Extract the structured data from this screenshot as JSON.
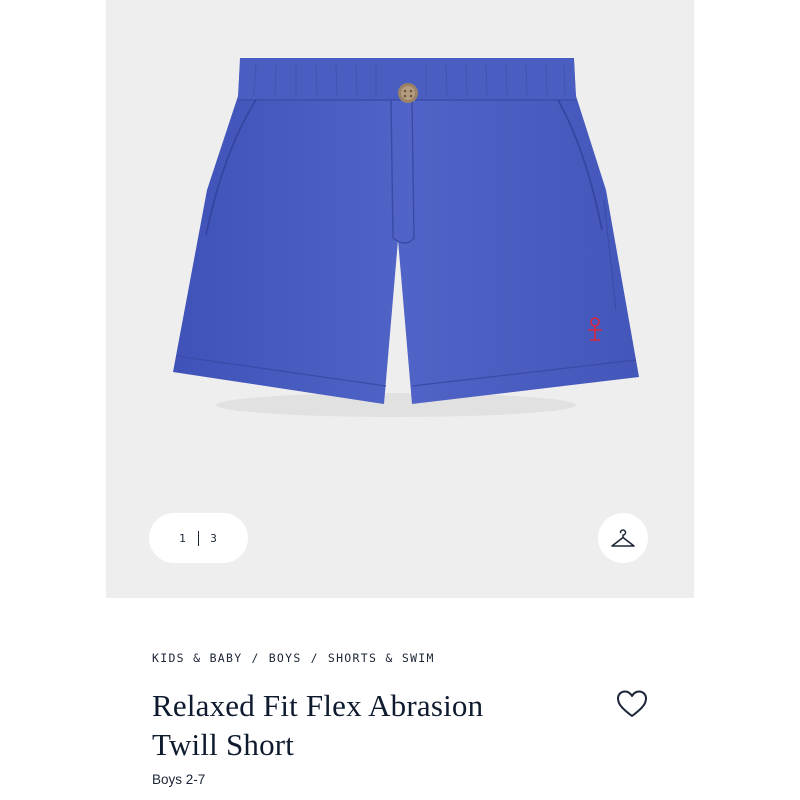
{
  "gallery": {
    "current_page": "1",
    "total_pages": "3",
    "image_icon": "shorts-image",
    "closet_icon": "hanger-icon"
  },
  "breadcrumb": [
    {
      "label": "KIDS & BABY"
    },
    {
      "label": "BOYS"
    },
    {
      "label": "SHORTS & SWIM"
    }
  ],
  "breadcrumb_separator": "/",
  "product": {
    "title_line1": "Relaxed Fit Flex Abrasion",
    "title_line2": "Twill Short",
    "subtitle": "Boys 2-7",
    "favorite_icon": "heart-icon"
  },
  "colors": {
    "short_color": "#4a5dc1",
    "logo_color": "#d7263d",
    "gallery_bg": "#efeeee",
    "text": "#1b2436"
  }
}
